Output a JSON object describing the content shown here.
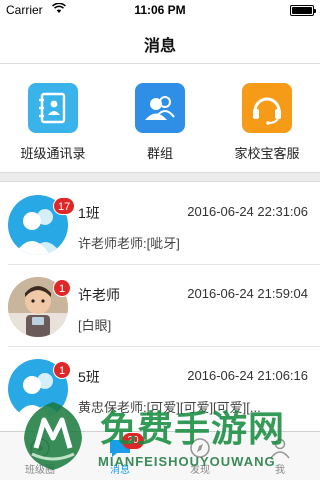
{
  "status_bar": {
    "carrier": "Carrier",
    "time": "11:06 PM"
  },
  "nav": {
    "title": "消息"
  },
  "shortcuts": [
    {
      "label": "班级通讯录",
      "icon": "contacts-book-icon",
      "color": "#3ab3ea"
    },
    {
      "label": "群组",
      "icon": "group-icon",
      "color": "#2f8fe6"
    },
    {
      "label": "家校宝客服",
      "icon": "headset-icon",
      "color": "#f59b18"
    }
  ],
  "chats": [
    {
      "name": "1班",
      "time": "2016-06-24 22:31:06",
      "preview": "许老师老师:[呲牙]",
      "badge": "17",
      "avatar": "group-avatar-icon"
    },
    {
      "name": "许老师",
      "time": "2016-06-24 21:59:04",
      "preview": "[白眼]",
      "badge": "1",
      "avatar": "child-photo"
    },
    {
      "name": "5班",
      "time": "2016-06-24 21:06:16",
      "preview": "黄忠保老师:[可爱][可爱][可爱][...",
      "badge": "1",
      "avatar": "group-avatar-icon"
    }
  ],
  "tabs": [
    {
      "label": "班级圈",
      "icon": "class-circle-icon"
    },
    {
      "label": "消息",
      "icon": "message-icon",
      "badge": "20"
    },
    {
      "label": "发现",
      "icon": "discover-icon"
    },
    {
      "label": "我",
      "icon": "profile-icon"
    }
  ],
  "watermark": {
    "title": "免费手游网",
    "subtitle": "MIANFEISHOUYOUWANG"
  },
  "colors": {
    "accent": "#1a9ee8",
    "badge": "#e02727",
    "watermark": "#188c40"
  }
}
